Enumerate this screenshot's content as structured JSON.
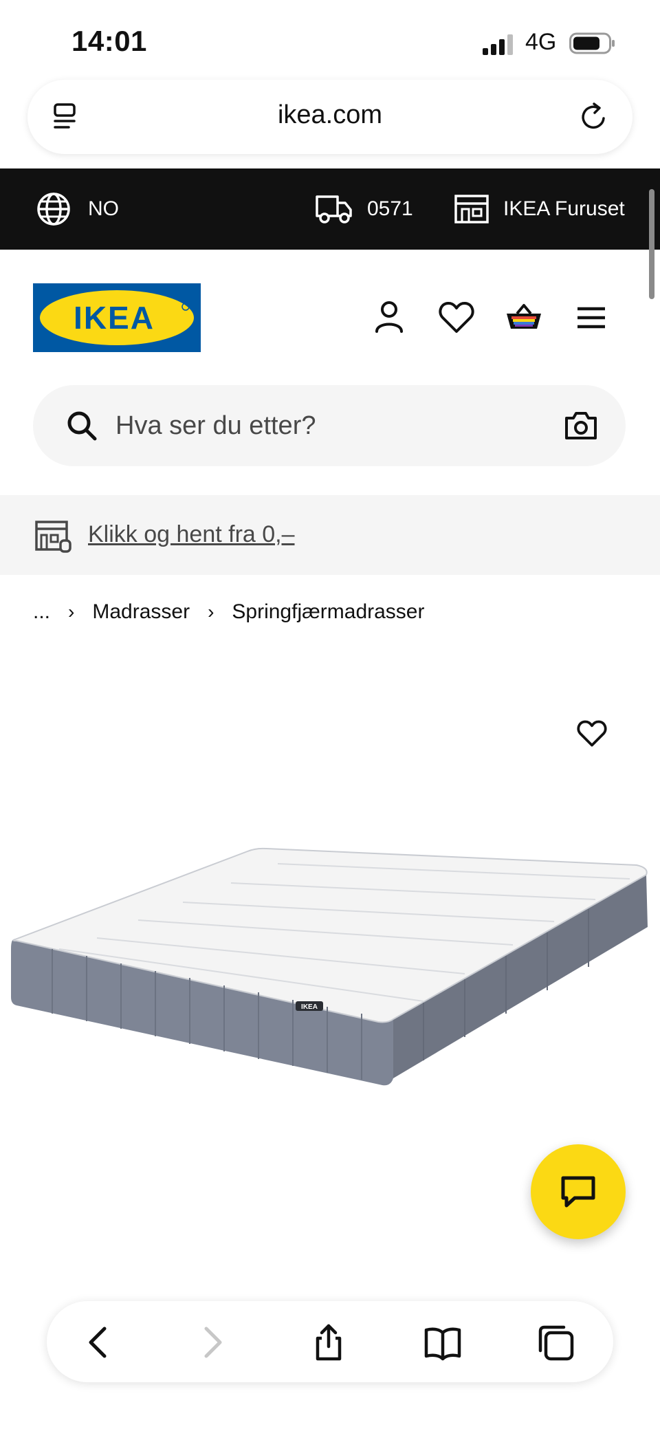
{
  "status_bar": {
    "time": "14:01",
    "network": "4G"
  },
  "browser": {
    "url": "ikea.com"
  },
  "topbar": {
    "language": "NO",
    "postcode": "0571",
    "store": "IKEA Furuset"
  },
  "header": {
    "logo_text": "IKEA"
  },
  "search": {
    "placeholder": "Hva ser du etter?"
  },
  "banner": {
    "link_text": "Klikk og hent fra 0,–"
  },
  "breadcrumb": {
    "items": [
      "...",
      "Madrasser",
      "Springfjærmadrasser"
    ],
    "separator": "›"
  },
  "product": {
    "mattress_label": "IKEA"
  },
  "colors": {
    "topbar_bg": "#111111",
    "ikea_blue": "#0058a3",
    "ikea_yellow": "#fbd914",
    "light_grey": "#f5f5f5"
  },
  "icons": {
    "topbar": [
      "globe-icon",
      "delivery-truck-icon",
      "store-icon"
    ],
    "header": [
      "user-icon",
      "heart-icon",
      "shopping-basket-icon",
      "hamburger-menu-icon"
    ],
    "toolbar": [
      "back-icon",
      "forward-icon",
      "share-icon",
      "bookmarks-icon",
      "tabs-icon"
    ]
  }
}
